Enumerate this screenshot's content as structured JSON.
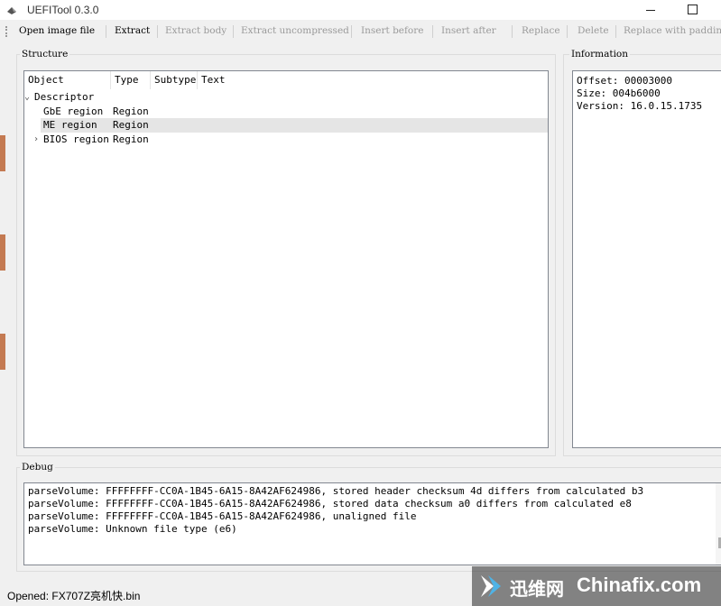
{
  "window": {
    "title": "UEFITool 0.3.0"
  },
  "toolbar": {
    "items": [
      {
        "label": "Open image file",
        "enabled": true
      },
      {
        "label": "Extract",
        "enabled": true
      },
      {
        "label": "Extract body",
        "enabled": false
      },
      {
        "label": "Extract uncompressed",
        "enabled": false
      },
      {
        "label": "Insert before",
        "enabled": false
      },
      {
        "label": "Insert after",
        "enabled": false
      },
      {
        "label": "Replace",
        "enabled": false
      },
      {
        "label": "Delete",
        "enabled": false
      },
      {
        "label": "Replace with padding",
        "enabled": false
      }
    ]
  },
  "structure": {
    "title": "Structure",
    "columns": [
      "Object",
      "Type",
      "Subtype",
      "Text"
    ],
    "rows": [
      {
        "object": "Descriptor",
        "type": "",
        "subtype": "",
        "text": "",
        "expander": "expanded",
        "selected": false
      },
      {
        "object": "GbE region",
        "type": "Region",
        "subtype": "",
        "text": "",
        "expander": "none",
        "selected": false
      },
      {
        "object": "ME region",
        "type": "Region",
        "subtype": "",
        "text": "",
        "expander": "none",
        "selected": true
      },
      {
        "object": "BIOS region",
        "type": "Region",
        "subtype": "",
        "text": "",
        "expander": "collapsed",
        "selected": false
      }
    ]
  },
  "information": {
    "title": "Information",
    "lines": [
      "Offset: 00003000",
      "Size: 004b6000",
      "Version: 16.0.15.1735"
    ]
  },
  "debug": {
    "title": "Debug",
    "lines": [
      "parseVolume: FFFFFFFF-CC0A-1B45-6A15-8A42AF624986, stored header checksum 4d differs from calculated b3",
      "parseVolume: FFFFFFFF-CC0A-1B45-6A15-8A42AF624986, stored data checksum a0 differs from calculated e8",
      "parseVolume: FFFFFFFF-CC0A-1B45-6A15-8A42AF624986, unaligned file",
      "parseVolume: Unknown file type (e6)"
    ]
  },
  "status": {
    "text": "Opened: FX707Z亮机快.bin"
  },
  "watermark": {
    "cn": "迅维网",
    "en": "Chinafix.com"
  },
  "colors": {
    "selection": "#e5e5e5",
    "border": "#828790",
    "disabled_text": "#9a9a9a"
  }
}
